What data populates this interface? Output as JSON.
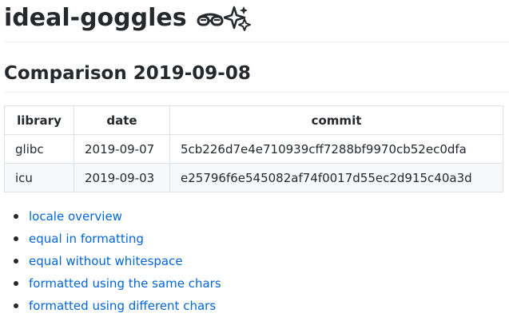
{
  "header": {
    "title": "ideal-goggles",
    "icons": [
      "goggles-icon",
      "sparkles-icon"
    ]
  },
  "section": {
    "heading": "Comparison 2019-09-08"
  },
  "table": {
    "columns": [
      "library",
      "date",
      "commit"
    ],
    "rows": [
      [
        "glibc",
        "2019-09-07",
        "5cb226d7e4e710939cff7288bf9970cb52ec0dfa"
      ],
      [
        "icu",
        "2019-09-03",
        "e25796f6e545082af74f0017d55ec2d915c40a3d"
      ]
    ]
  },
  "links": [
    "locale overview",
    "equal in formatting",
    "equal without whitespace",
    "formatted using the same chars",
    "formatted using different chars"
  ],
  "colors": {
    "text": "#24292e",
    "link": "#0366d6",
    "rule": "#eaecef",
    "table_border": "#dfe2e5",
    "stripe": "#f6f8fa"
  }
}
